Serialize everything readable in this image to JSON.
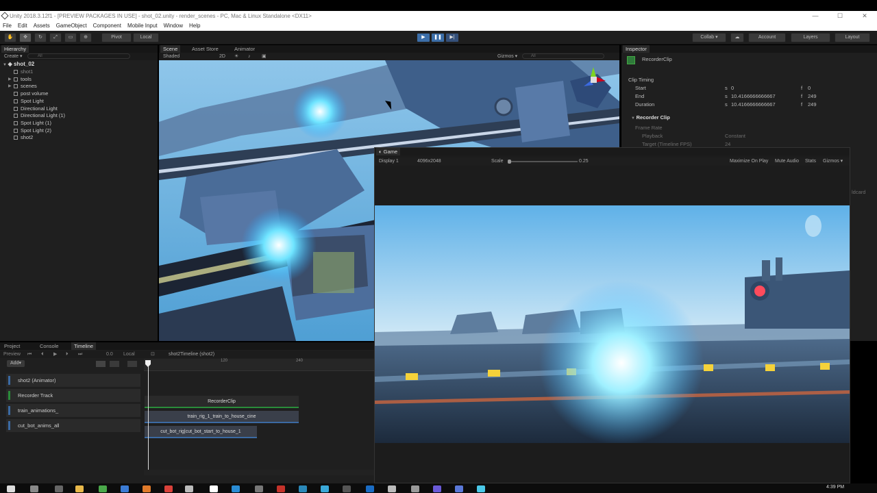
{
  "title_bar": {
    "text": "Unity 2018.3.12f1 - [PREVIEW PACKAGES IN USE] - shot_02.unity - render_scenes - PC, Mac & Linux Standalone <DX11>"
  },
  "window_controls": {
    "minimize": "—",
    "maximize": "☐",
    "close": "✕"
  },
  "menu": [
    "File",
    "Edit",
    "Assets",
    "GameObject",
    "Component",
    "Mobile Input",
    "Window",
    "Help"
  ],
  "toolbar": {
    "pivot": "Pivot",
    "local": "Local",
    "collab": "Collab ▾",
    "account": "Account",
    "layers": "Layers",
    "layout": "Layout"
  },
  "hierarchy": {
    "tab": "Hierarchy",
    "create": "Create ▾",
    "search_placeholder": "All",
    "root": "shot_02",
    "items": [
      {
        "label": "shot1",
        "dim": true,
        "arrow": false
      },
      {
        "label": "tools",
        "dim": false,
        "arrow": true
      },
      {
        "label": "scenes",
        "dim": false,
        "arrow": true
      },
      {
        "label": "post volume",
        "dim": false,
        "arrow": false
      },
      {
        "label": "Spot Light",
        "dim": false,
        "arrow": false
      },
      {
        "label": "Directional Light",
        "dim": false,
        "arrow": false
      },
      {
        "label": "Directional Light (1)",
        "dim": false,
        "arrow": false
      },
      {
        "label": "Spot Light (1)",
        "dim": false,
        "arrow": false
      },
      {
        "label": "Spot Light (2)",
        "dim": false,
        "arrow": false
      },
      {
        "label": "shot2",
        "dim": false,
        "arrow": false
      }
    ]
  },
  "scene_tabs": {
    "scene": "Scene",
    "asset_store": "Asset Store",
    "animator": "Animator"
  },
  "scene_toolbar": {
    "shading": "Shaded",
    "mode_2d": "2D",
    "gizmos": "Gizmos ▾",
    "search_placeholder": "All"
  },
  "game": {
    "tab": "Game",
    "display": "Display 1",
    "resolution": "4096x2048",
    "scale_label": "Scale",
    "scale_value": "0.25",
    "maximize": "Maximize On Play",
    "mute": "Mute Audio",
    "stats": "Stats",
    "gizmos": "Gizmos ▾"
  },
  "inspector": {
    "tab": "Inspector",
    "object_name": "RecorderClip",
    "section_timing": "Clip Timing",
    "rows": [
      {
        "label": "Start",
        "s": "0",
        "f": "0"
      },
      {
        "label": "End",
        "s": "10.4166666666667",
        "f": "249"
      },
      {
        "label": "Duration",
        "s": "10.4166666666667",
        "f": "249"
      }
    ],
    "section_recorder": "Recorder Clip",
    "frame_rate": "Frame Rate",
    "playback_label": "Playback",
    "playback_value": "Constant",
    "target_label": "Target (Timeline FPS)",
    "target_value": "24",
    "side_text": "ldcard"
  },
  "bottom_tabs": {
    "project": "Project",
    "console": "Console",
    "timeline": "Timeline"
  },
  "timeline": {
    "preview": "Preview",
    "frame": "0.0",
    "local": "Local",
    "add": "Add▾",
    "asset": "shot2Timeline (shot2)",
    "ruler_labels": [
      "120",
      "240"
    ],
    "tracks": [
      {
        "label": "shot2 (Animator)",
        "color": "#3b6aa3"
      },
      {
        "label": "Recorder Track",
        "color": "#2a8c3a"
      },
      {
        "label": "train_animations_",
        "color": "#3b6aa3"
      },
      {
        "label": "cut_bot_anims_all",
        "color": "#3b6aa3"
      }
    ],
    "clips": [
      {
        "label": "RecorderClip"
      },
      {
        "label": "train_rig_1_train_to_house_cine"
      },
      {
        "label": "cut_bot_rig|cut_bot_start_to_house_1"
      }
    ]
  },
  "taskbar": {
    "time": "4:39 PM"
  }
}
